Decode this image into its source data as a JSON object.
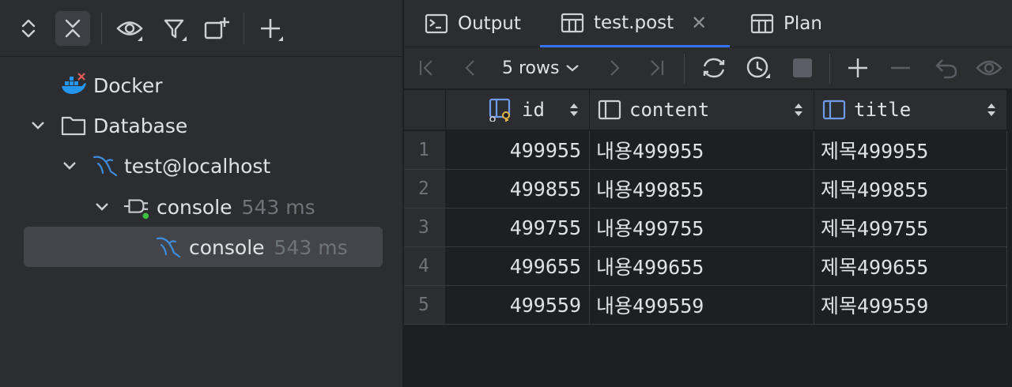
{
  "sidebar": {
    "tree": [
      {
        "label": "Docker",
        "icon": "docker-icon"
      },
      {
        "label": "Database",
        "icon": "folder-icon"
      },
      {
        "label": "test@localhost",
        "icon": "mysql-icon"
      },
      {
        "label": "console",
        "time": "543 ms",
        "icon": "session-icon"
      },
      {
        "label": "console",
        "time": "543 ms",
        "icon": "mysql-icon"
      }
    ]
  },
  "tabs": [
    {
      "label": "Output",
      "icon": "console-icon"
    },
    {
      "label": "test.post",
      "icon": "table-icon"
    },
    {
      "label": "Plan",
      "icon": "table-icon"
    }
  ],
  "grid_toolbar": {
    "rows_label": "5 rows"
  },
  "table": {
    "columns": [
      "id",
      "content",
      "title"
    ],
    "rows": [
      {
        "n": "1",
        "id": "499955",
        "content": "내용499955",
        "title": "제목499955"
      },
      {
        "n": "2",
        "id": "499855",
        "content": "내용499855",
        "title": "제목499855"
      },
      {
        "n": "3",
        "id": "499755",
        "content": "내용499755",
        "title": "제목499755"
      },
      {
        "n": "4",
        "id": "499655",
        "content": "내용499655",
        "title": "제목499655"
      },
      {
        "n": "5",
        "id": "499559",
        "content": "내용499559",
        "title": "제목499559"
      }
    ]
  },
  "colors": {
    "accent": "#3574f0",
    "mysql": "#3d8ddb",
    "docker": "#2496ed",
    "error": "#e55b5b",
    "ok": "#3fc03f",
    "key": "#e0b34a"
  }
}
